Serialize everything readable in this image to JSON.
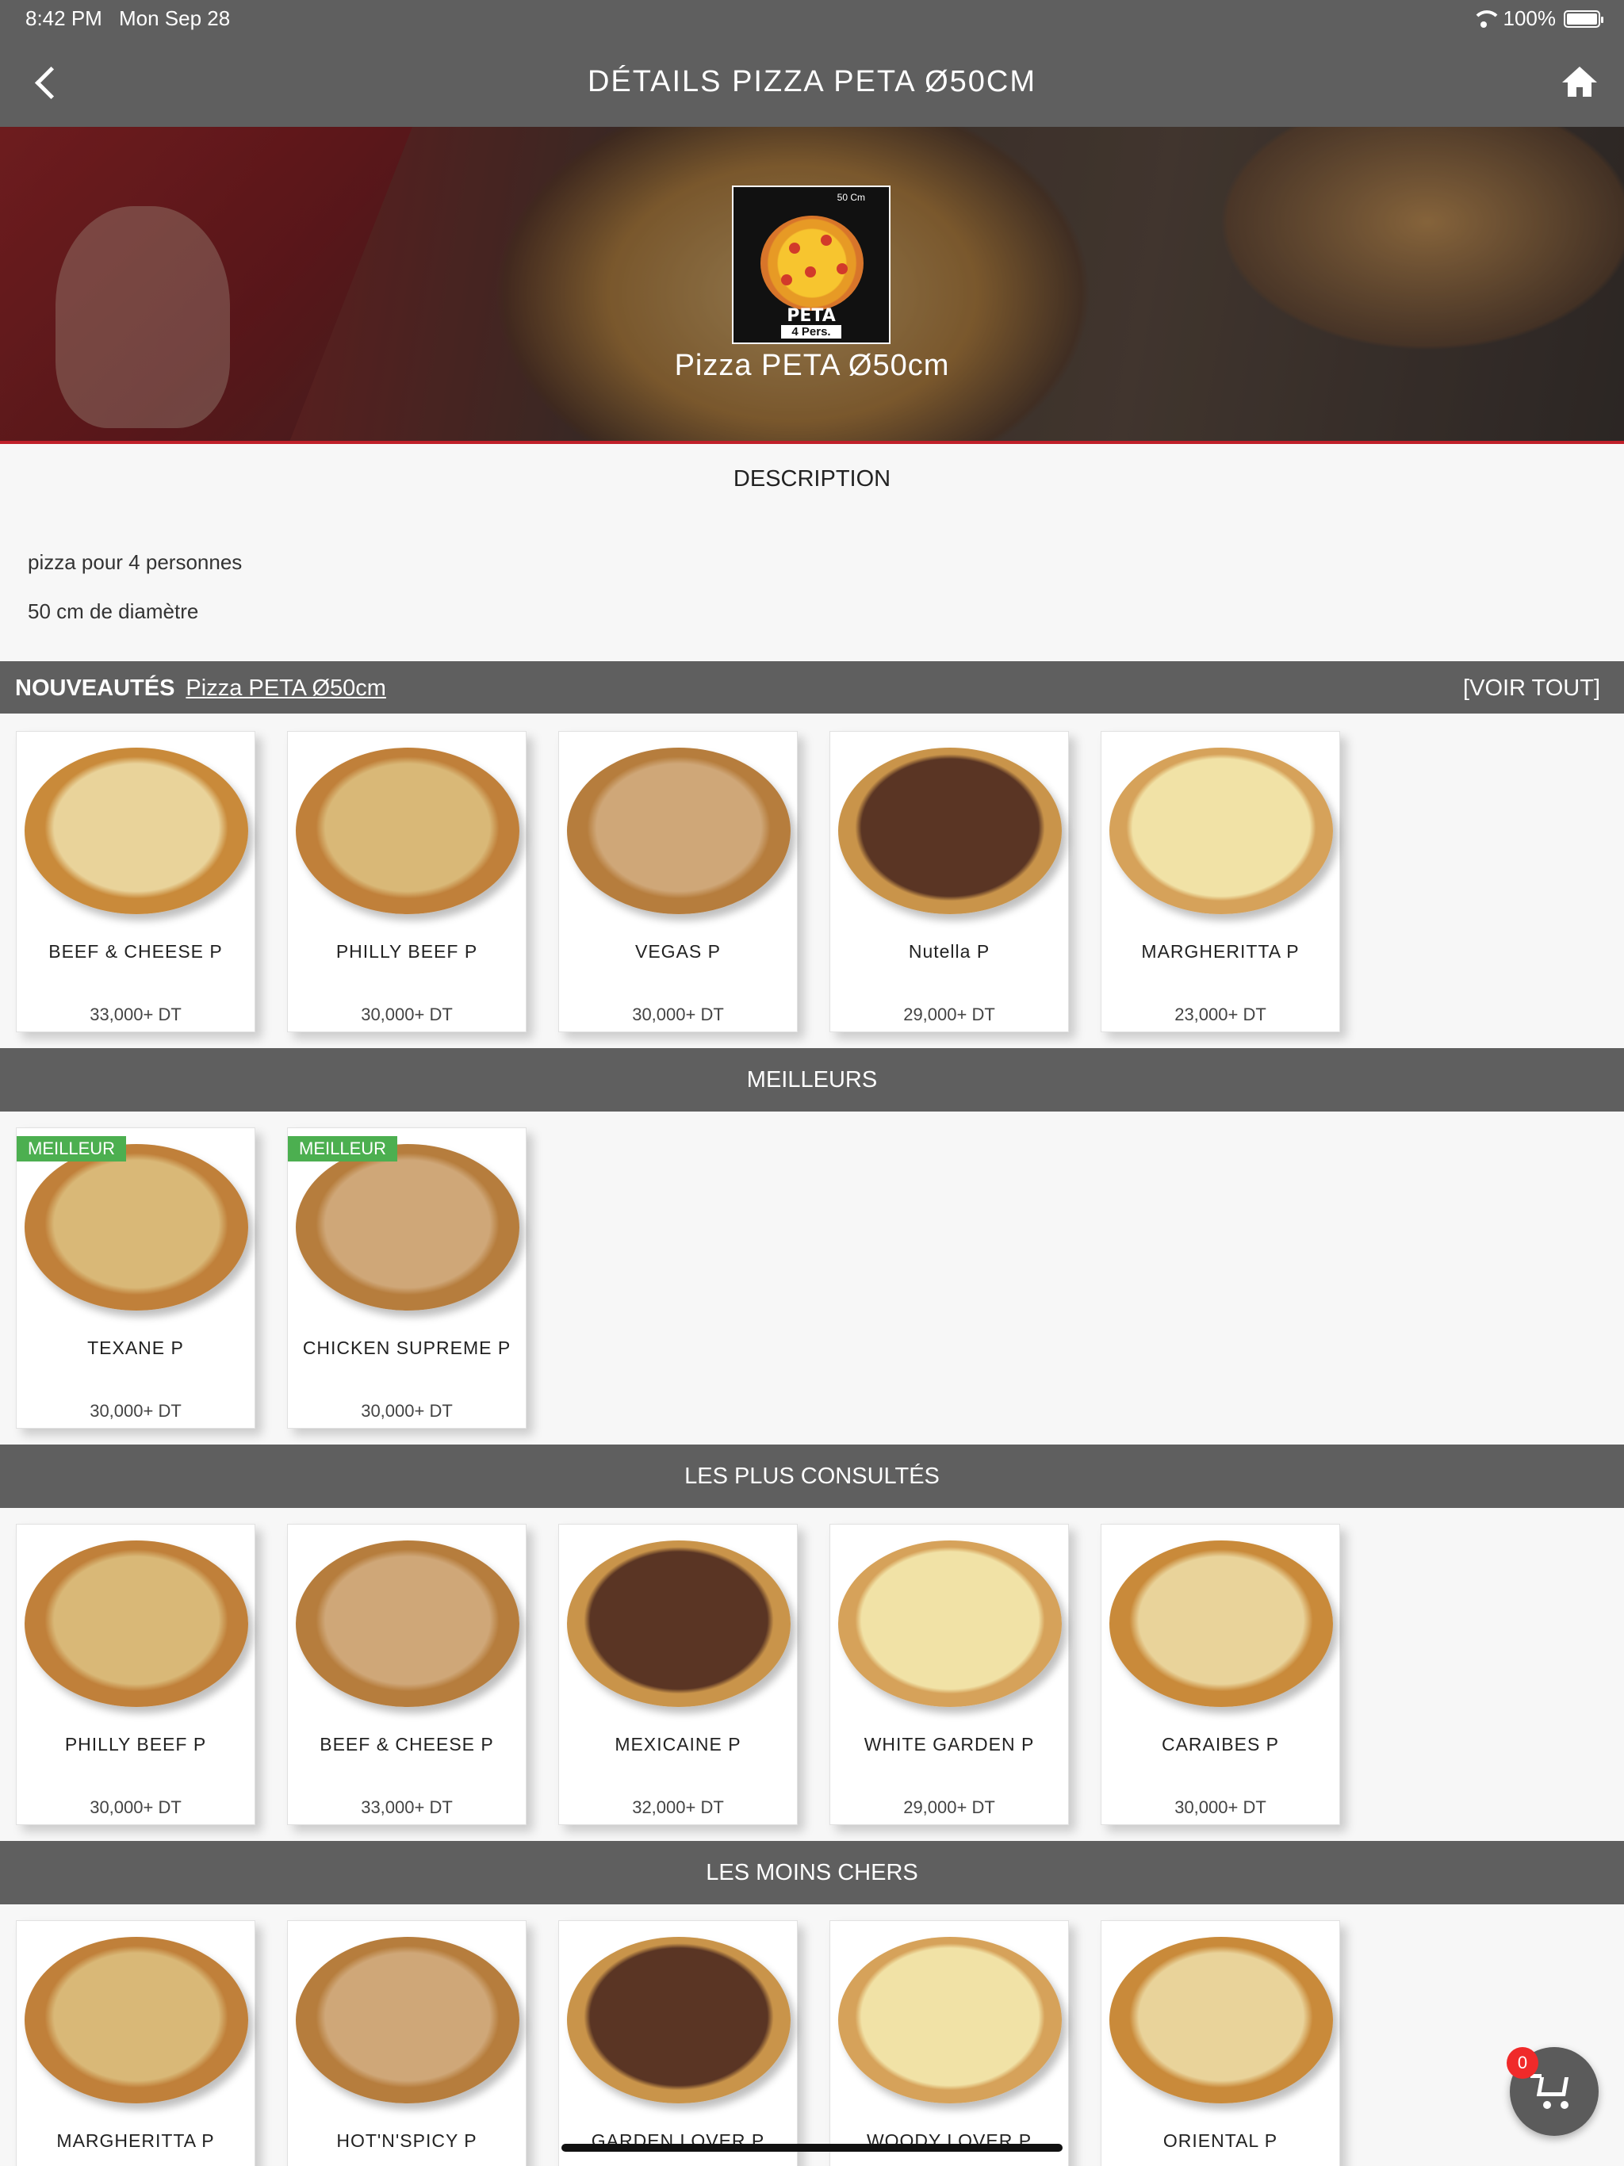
{
  "status": {
    "time": "8:42 PM",
    "date": "Mon Sep 28",
    "battery": "100%"
  },
  "nav": {
    "title": "DÉTAILS  PIZZA  PETA    Ø50CM"
  },
  "hero": {
    "title": "Pizza  PETA    Ø50cm",
    "logo_top": "50 Cm",
    "logo_name": "PETA",
    "logo_sub": "4 Pers."
  },
  "description": {
    "heading": "DESCRIPTION",
    "lines": [
      "pizza  pour  4  personnes",
      "50  cm  de  diamètre"
    ]
  },
  "nouveautes": {
    "label": "NOUVEAUTÉS",
    "link": "Pizza  PETA    Ø50cm",
    "see_all": "[VOIR  TOUT]",
    "items": [
      {
        "name": "BEEF  &  CHEESE  P",
        "price": "33,000+  DT"
      },
      {
        "name": "PHILLY  BEEF  P",
        "price": "30,000+  DT"
      },
      {
        "name": "VEGAS  P",
        "price": "30,000+  DT"
      },
      {
        "name": "Nutella  P",
        "price": "29,000+  DT"
      },
      {
        "name": "MARGHERITTA  P",
        "price": "23,000+  DT"
      }
    ]
  },
  "meilleurs": {
    "label": "MEILLEURS",
    "badge": "MEILLEUR",
    "items": [
      {
        "name": "TEXANE  P",
        "price": "30,000+  DT"
      },
      {
        "name": "CHICKEN  SUPREME  P",
        "price": "30,000+  DT"
      }
    ]
  },
  "consultes": {
    "label": "LES  PLUS  CONSULTÉS",
    "items": [
      {
        "name": "PHILLY  BEEF  P",
        "price": "30,000+  DT"
      },
      {
        "name": "BEEF  &  CHEESE  P",
        "price": "33,000+  DT"
      },
      {
        "name": "MEXICAINE  P",
        "price": "32,000+  DT"
      },
      {
        "name": "WHITE  GARDEN  P",
        "price": "29,000+  DT"
      },
      {
        "name": "CARAIBES  P",
        "price": "30,000+  DT"
      }
    ]
  },
  "moins_chers": {
    "label": "LES  MOINS  CHERS",
    "items": [
      {
        "name": "MARGHERITTA  P"
      },
      {
        "name": "HOT'N'SPICY  P"
      },
      {
        "name": "GARDEN  LOVER  P"
      },
      {
        "name": "WOODY  LOVER  P"
      },
      {
        "name": "ORIENTAL  P"
      }
    ]
  },
  "cart": {
    "count": "0"
  },
  "colors": {
    "bar": "#5f5f5f",
    "badge": "#4caf50",
    "cart_badge": "#f02a2a",
    "accent_line": "#c0202a"
  },
  "icons": [
    "back-chevron-icon",
    "home-icon",
    "wifi-icon",
    "battery-icon",
    "cart-icon"
  ]
}
